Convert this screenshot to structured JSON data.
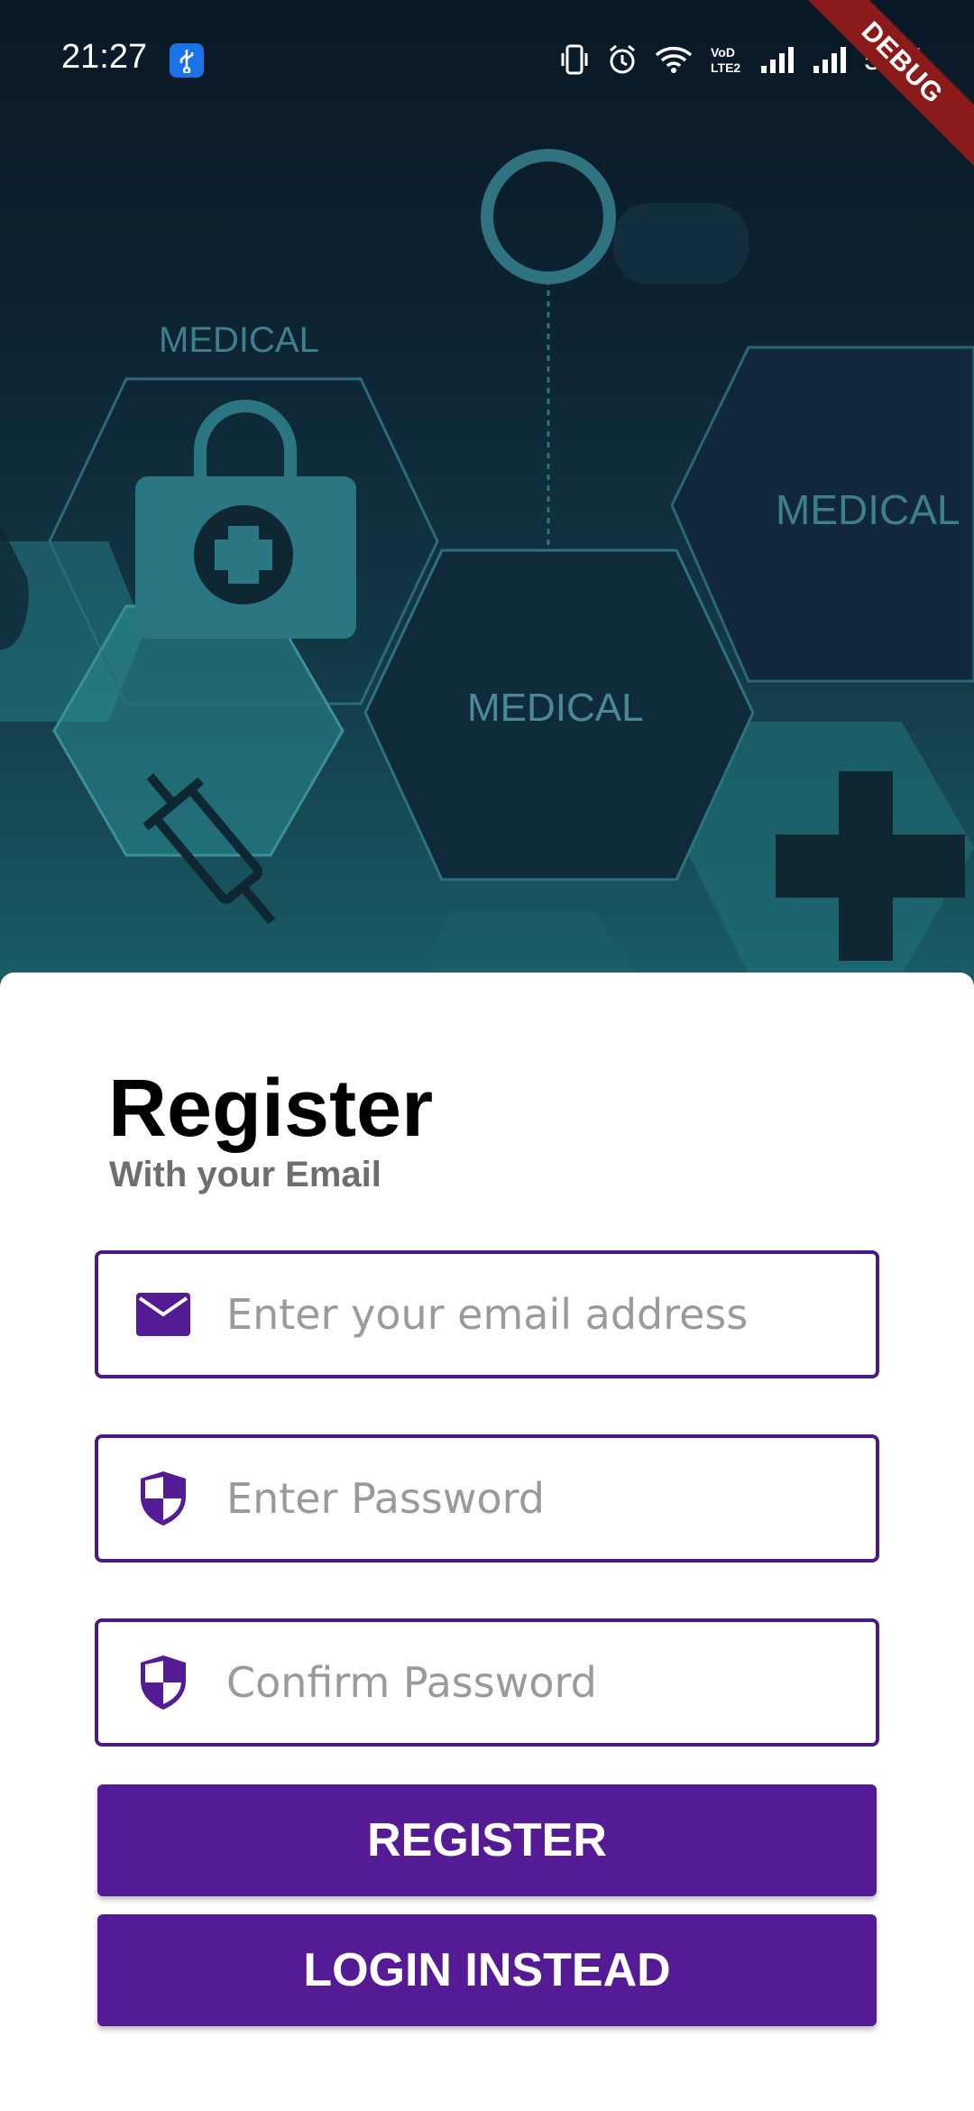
{
  "status_bar": {
    "time": "21:27",
    "battery": "56%",
    "network_label": "VoLTE2",
    "icons": [
      "usb-icon",
      "vibrate-icon",
      "alarm-icon",
      "wifi-icon",
      "volte-icon",
      "signal-icon",
      "signal-icon",
      "battery-icon"
    ]
  },
  "debug_banner": "DEBUG",
  "hero": {
    "labels": [
      "MEDICAL",
      "MEDICAL",
      "MEDICAL"
    ]
  },
  "form": {
    "title": "Register",
    "subtitle": "With your Email",
    "email": {
      "placeholder": "Enter your email address",
      "value": "",
      "icon": "mail-icon"
    },
    "password": {
      "placeholder": "Enter Password",
      "value": "",
      "icon": "shield-icon"
    },
    "confirm_password": {
      "placeholder": "Confirm Password",
      "value": "",
      "icon": "shield-icon"
    },
    "register_label": "REGISTER",
    "login_label": "LOGIN INSTEAD"
  },
  "colors": {
    "primary": "#541b95",
    "field_border": "#4a1a86",
    "icon": "#541b95",
    "hero_dark": "#0a1826",
    "hero_teal": "#1a5d66"
  }
}
